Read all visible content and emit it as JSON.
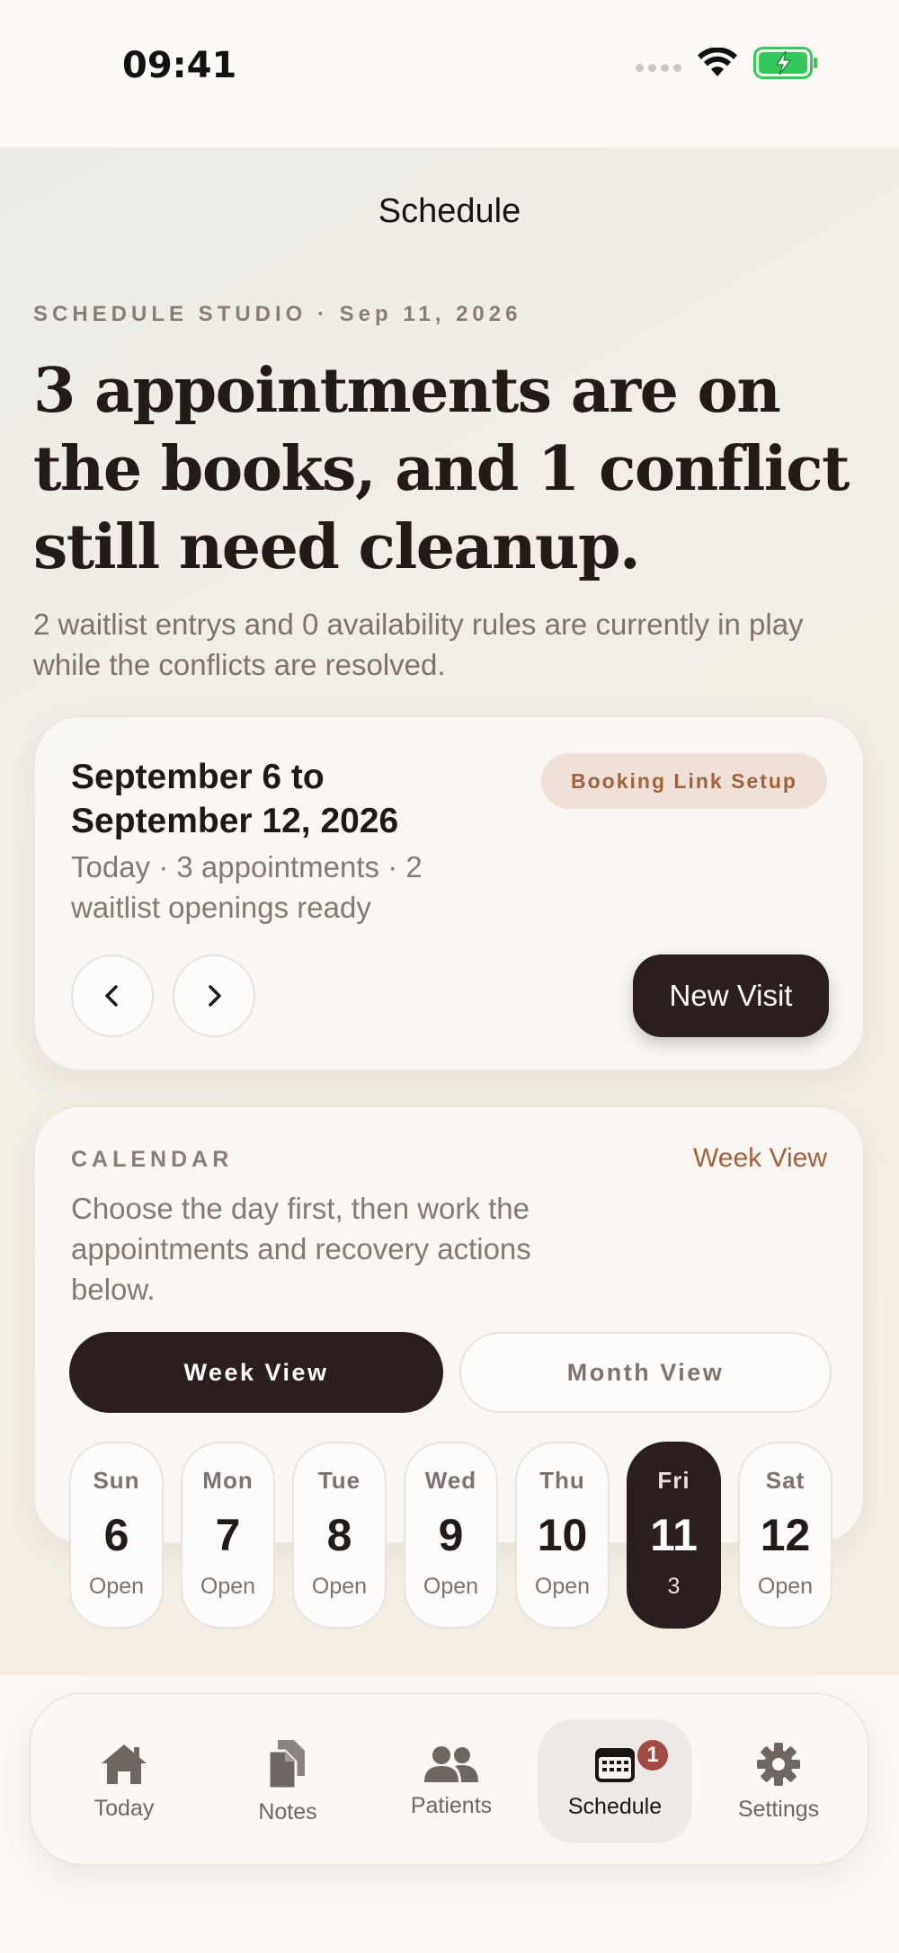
{
  "status_bar": {
    "time": "09:41"
  },
  "nav": {
    "title": "Schedule"
  },
  "hero": {
    "eyebrow": "SCHEDULE STUDIO  ·  Sep 11, 2026",
    "headline": "3 appointments are on the books, and 1 conflict still need cleanup.",
    "subhead": "2 waitlist entrys and 0 availability rules are currently in play while the conflicts are resolved."
  },
  "week_card": {
    "range_title": "September 6 to September 12, 2026",
    "summary": "Today · 3 appointments · 2 waitlist openings ready",
    "badge": "Booking Link Setup",
    "new_visit_label": "New Visit"
  },
  "calendar": {
    "eyebrow": "CALENDAR",
    "view_link": "Week View",
    "description": "Choose the day first, then work the appointments and recovery actions below.",
    "segments": {
      "week": "Week View",
      "month": "Month View"
    },
    "days": [
      {
        "name": "Sun",
        "num": "6",
        "status": "Open"
      },
      {
        "name": "Mon",
        "num": "7",
        "status": "Open"
      },
      {
        "name": "Tue",
        "num": "8",
        "status": "Open"
      },
      {
        "name": "Wed",
        "num": "9",
        "status": "Open"
      },
      {
        "name": "Thu",
        "num": "10",
        "status": "Open"
      },
      {
        "name": "Fri",
        "num": "11",
        "status": "3"
      },
      {
        "name": "Sat",
        "num": "12",
        "status": "Open"
      }
    ]
  },
  "tabs": [
    {
      "label": "Today",
      "icon": "house-icon"
    },
    {
      "label": "Notes",
      "icon": "documents-icon"
    },
    {
      "label": "Patients",
      "icon": "people-icon"
    },
    {
      "label": "Schedule",
      "icon": "calendar-icon",
      "badge": "1",
      "active": true
    },
    {
      "label": "Settings",
      "icon": "gear-icon"
    }
  ],
  "colors": {
    "accent": "#a3603e",
    "dark": "#2a1f1c",
    "badge": "#a24a45",
    "battery": "#34c759"
  }
}
